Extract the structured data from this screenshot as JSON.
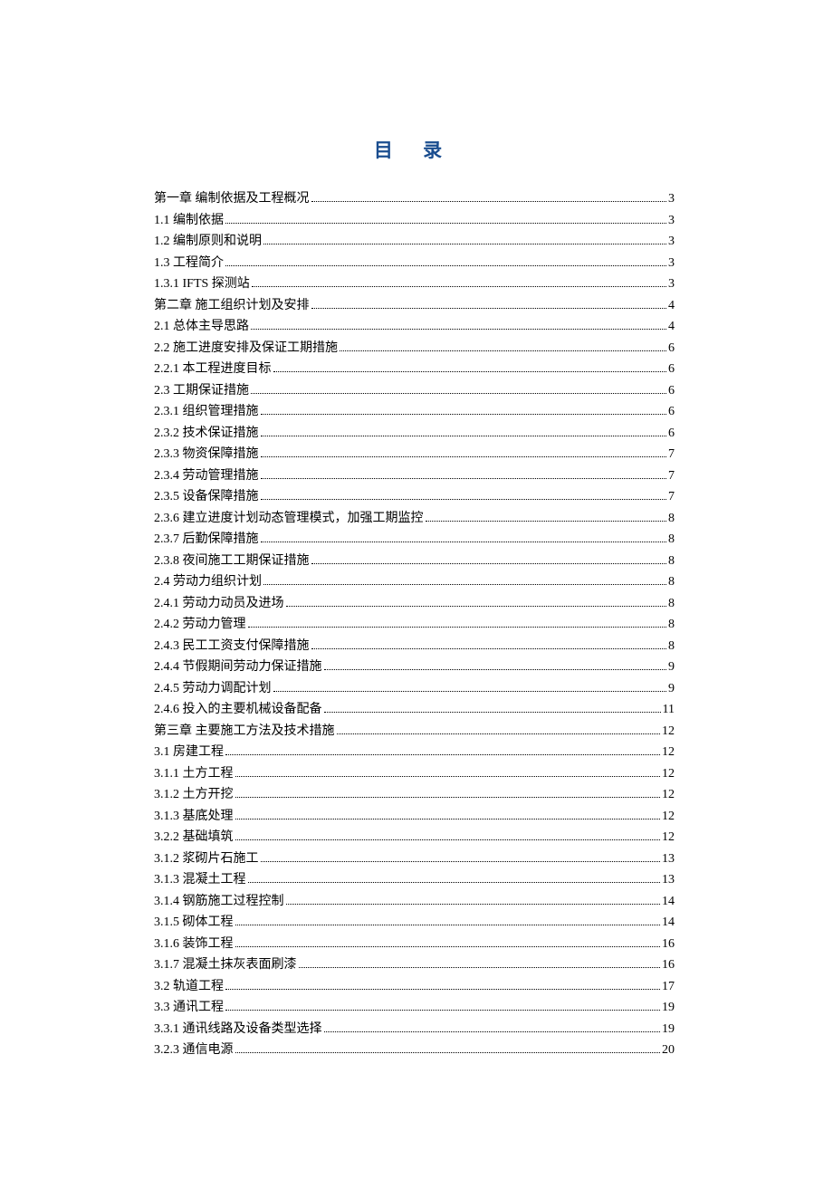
{
  "title": "目 录",
  "entries": [
    {
      "label": "第一章  编制依据及工程概况",
      "page": "3"
    },
    {
      "label": "1.1 编制依据",
      "page": "3"
    },
    {
      "label": "1.2 编制原则和说明",
      "page": "3"
    },
    {
      "label": "1.3 工程简介",
      "page": "3"
    },
    {
      "label": "1.3.1  IFTS 探测站",
      "page": "3"
    },
    {
      "label": "第二章  施工组织计划及安排",
      "page": "4"
    },
    {
      "label": "2.1 总体主导思路",
      "page": "4"
    },
    {
      "label": "2.2 施工进度安排及保证工期措施",
      "page": "6"
    },
    {
      "label": "2.2.1 本工程进度目标",
      "page": "6"
    },
    {
      "label": "2.3 工期保证措施",
      "page": "6"
    },
    {
      "label": "2.3.1 组织管理措施",
      "page": "6"
    },
    {
      "label": "2.3.2 技术保证措施",
      "page": "6"
    },
    {
      "label": "2.3.3 物资保障措施",
      "page": "7"
    },
    {
      "label": "2.3.4 劳动管理措施",
      "page": "7"
    },
    {
      "label": "2.3.5 设备保障措施",
      "page": "7"
    },
    {
      "label": "2.3.6  建立进度计划动态管理模式，加强工期监控",
      "page": "8"
    },
    {
      "label": "2.3.7 后勤保障措施",
      "page": "8"
    },
    {
      "label": "2.3.8 夜间施工工期保证措施",
      "page": "8"
    },
    {
      "label": "2.4 劳动力组织计划",
      "page": "8"
    },
    {
      "label": "2.4.1 劳动力动员及进场",
      "page": "8"
    },
    {
      "label": "2.4.2 劳动力管理",
      "page": "8"
    },
    {
      "label": "2.4.3 民工工资支付保障措施",
      "page": "8"
    },
    {
      "label": "2.4.4 节假期间劳动力保证措施",
      "page": "9"
    },
    {
      "label": "2.4.5 劳动力调配计划 ",
      "page": "9"
    },
    {
      "label": "2.4.6  投入的主要机械设备配备",
      "page": "11"
    },
    {
      "label": "第三章  主要施工方法及技术措施",
      "page": "12"
    },
    {
      "label": "3.1 房建工程",
      "page": "12"
    },
    {
      "label": "3.1.1 土方工程",
      "page": "12"
    },
    {
      "label": "3.1.2 土方开挖",
      "page": " 12"
    },
    {
      "label": "3.1.3 基底处理",
      "page": "12"
    },
    {
      "label": "3.2.2 基础填筑",
      "page": "12"
    },
    {
      "label": "3.1.2 浆砌片石施工",
      "page": "13"
    },
    {
      "label": "3.1.3 混凝土工程",
      "page": "13"
    },
    {
      "label": "3.1.4 钢筋施工过程控制",
      "page": "14"
    },
    {
      "label": "3.1.5 砌体工程",
      "page": "14"
    },
    {
      "label": "3.1.6 装饰工程",
      "page": "16"
    },
    {
      "label": "3.1.7 混凝土抹灰表面刷漆",
      "page": "16"
    },
    {
      "label": "3.2 轨道工程",
      "page": "17"
    },
    {
      "label": "3.3 通讯工程",
      "page": "19"
    },
    {
      "label": "3.3.1 通讯线路及设备类型选择 ",
      "page": "19"
    },
    {
      "label": "3.2.3 通信电源 ",
      "page": "20"
    }
  ]
}
